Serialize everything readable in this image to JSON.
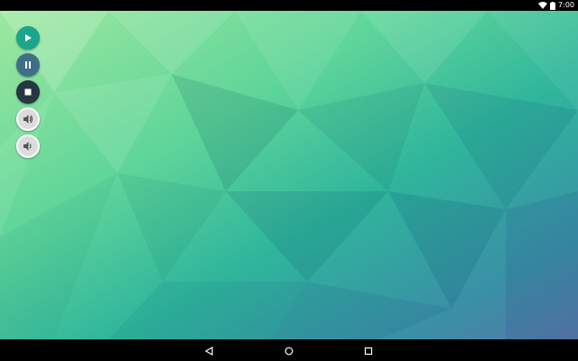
{
  "status_bar": {
    "time": "7:00",
    "icons": [
      "wifi-icon",
      "battery-icon"
    ]
  },
  "controls": [
    {
      "name": "play",
      "icon": "play-icon",
      "color": "#1aa58c"
    },
    {
      "name": "pause",
      "icon": "pause-icon",
      "color": "#3f6f88"
    },
    {
      "name": "stop",
      "icon": "stop-icon",
      "color": "#263644"
    },
    {
      "name": "volume-up",
      "icon": "volume-up-icon",
      "color": "#dcdcdc"
    },
    {
      "name": "volume-down",
      "icon": "volume-down-icon",
      "color": "#dcdcdc"
    }
  ],
  "navigation_bar": {
    "buttons": [
      "back-icon",
      "home-icon",
      "recents-icon"
    ]
  },
  "wallpaper": {
    "style": "low-poly gradient",
    "colors": [
      "#8ee59a",
      "#2fbf9a",
      "#2a9aa0",
      "#4f7fa8"
    ]
  }
}
